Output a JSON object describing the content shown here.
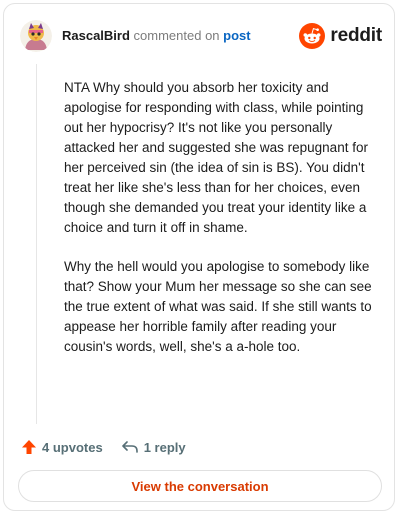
{
  "header": {
    "author": "RascalBird",
    "verb": "commented on",
    "post_link": "post",
    "brand_name": "reddit",
    "avatar_icon": "bird-avatar-icon",
    "brand_icon": "reddit-alien-icon"
  },
  "comment": {
    "paragraphs": [
      "NTA Why should you absorb her toxicity and apologise for responding with class, while pointing out her hypocrisy? It's not like you personally attacked her and suggested she was repugnant for her perceived sin (the idea of sin is BS). You didn't treat her like she's less than for her choices, even though she demanded you treat your identity like a choice and turn it off in shame.",
      "Why the hell would you apologise to somebody like that? Show your Mum her message so she can see the true extent of what was said. If she still wants to appease her horrible family after reading your cousin's words, well, she's a a-hole too."
    ]
  },
  "actions": {
    "upvotes_label": "4 upvotes",
    "reply_label": "1 reply",
    "upvote_icon": "upvote-arrow-icon",
    "reply_icon": "reply-arrow-icon"
  },
  "footer": {
    "view_label": "View the conversation"
  },
  "colors": {
    "brand_orange": "#ff4500",
    "link_blue": "#0a66c2",
    "cta_red": "#d93a00",
    "muted_gray": "#576f76"
  }
}
